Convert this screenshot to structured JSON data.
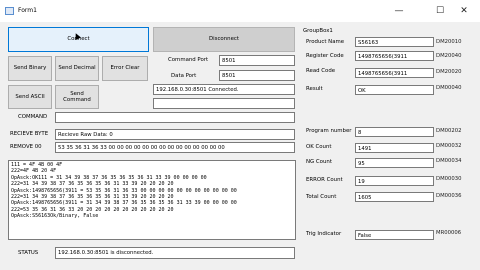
{
  "window": {
    "title": "Form1",
    "minimize": "—",
    "maximize": "☐",
    "close": "✕"
  },
  "buttons": {
    "connect": "Connect",
    "disconnect": "Disconnect",
    "send_binary": "Send Binary",
    "send_decimal": "Send Decimal",
    "error_clear": "Error Clear",
    "send_ascii": "Send ASCII",
    "send_command": "Send\nCommand"
  },
  "connection": {
    "command_port_label": "Command Port",
    "command_port": "8501",
    "data_port_label": "Data Port",
    "data_port": "8501",
    "status_message": "192.168.0.30:8501 Connected.",
    "extra_field": ""
  },
  "command": {
    "label": "COMMAND",
    "value": ""
  },
  "receive_byte": {
    "label": "RECIEVE BYTE",
    "value": "Recieve Raw Data: 0"
  },
  "remove": {
    "label": "REMOVE 00",
    "value": "53 35 36 31 36 33 00 00 00 00 00 00 00 00 00 00 00 00 00 00"
  },
  "log_lines": [
    "111 = 4F 4B 00 4F",
    "222=4F 4B 20 4F",
    "OpAsck:OK111 = 31 34 39 38 37 36 35 36 35 36 31 33 39 00 00 00 00",
    "222=31 34 39 38 37 36 35 36 35 36 31 33 39 20 20 20 20",
    "OpAsck:1498765656(3911 = 53 35 36 31 36 33 00 00 00 00 00 00 00 00 00 00 00",
    "222=31 34 39 38 37 36 35 36 35 36 31 33 39 20 20 20 20",
    "OpAsck:1498765656(3911 = 31 34 39 38 37 36 35 36 35 36 31 33 39 00 00 00 00",
    "222=53 35 36 31 36 33 20 20 20 20 20 20 20 20 20 20 20",
    "OpAsck:S56163Ok/Binary, False"
  ],
  "status": {
    "label": "STATUS",
    "value": "192.168.0.30:8501 is disconnected."
  },
  "groupbox": {
    "title": "GroupBox1",
    "fields": [
      {
        "label": "Product Name",
        "value": "S56163",
        "dm": "DM20010"
      },
      {
        "label": "Register Code",
        "value": "1498765656(3911",
        "dm": "DM20040"
      },
      {
        "label": "Read Code",
        "value": "1498765656(3911",
        "dm": "DM20020"
      },
      {
        "label": "Result",
        "value": "OK",
        "dm": "DM00040"
      },
      {
        "label": "Program number",
        "value": "8",
        "dm": "DM00202"
      },
      {
        "label": "OK Count",
        "value": "1491",
        "dm": "DM00032"
      },
      {
        "label": "NG Count",
        "value": "95",
        "dm": "DM00034"
      },
      {
        "label": "ERROR Count",
        "value": "19",
        "dm": "DM00030"
      },
      {
        "label": "Total Count",
        "value": "1605",
        "dm": "DM00036"
      },
      {
        "label": "Trig Indicator",
        "value": "False",
        "dm": "MR00006"
      }
    ]
  }
}
